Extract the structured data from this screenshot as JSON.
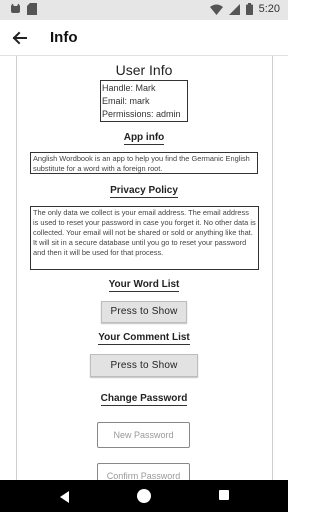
{
  "status_bar": {
    "time": "5:20",
    "icons": [
      "cat-icon",
      "sd-card-icon",
      "wifi-icon",
      "signal-icon",
      "battery-icon"
    ]
  },
  "app_bar": {
    "title": "Info",
    "back_icon": "arrow-left-icon"
  },
  "user_info": {
    "title": "User Info",
    "handle": "Handle: Mark",
    "email": "Email: mark",
    "permissions": "Permissions: admin"
  },
  "app_info": {
    "title": "App info",
    "text": "Anglish Wordbook is an app to help you find the Germanic English substitute for a word with a foreign root."
  },
  "privacy_policy": {
    "title": "Privacy Policy",
    "text": "The only data we collect is your email address.  The email address is used to reset your password in case you forget it. No other data is collected. Your email will not be shared or sold or anything like that.  It will sit in a secure database until you go to reset your password and then it will be used for that process."
  },
  "word_list": {
    "title": "Your Word List",
    "button_label": "Press to Show"
  },
  "comment_list": {
    "title": "Your Comment List",
    "button_label": "Press to Show"
  },
  "change_password": {
    "title": "Change Password",
    "new_password_placeholder": "New Password",
    "confirm_password_placeholder": "Confirm Password"
  },
  "nav_bar": {
    "icons": [
      "back-triangle-icon",
      "home-circle-icon",
      "recents-square-icon"
    ]
  }
}
